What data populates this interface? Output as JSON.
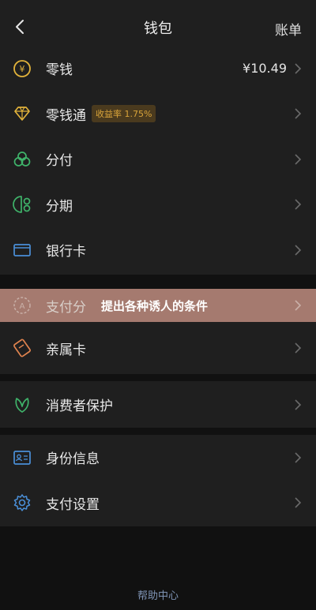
{
  "header": {
    "title": "钱包",
    "bill_label": "账单"
  },
  "group1": [
    {
      "label": "零钱",
      "value": "¥10.49",
      "icon": "coin-icon"
    },
    {
      "label": "零钱通",
      "badge": "收益率 1.75%",
      "icon": "diamond-icon"
    },
    {
      "label": "分付",
      "icon": "clover-icon"
    },
    {
      "label": "分期",
      "icon": "installment-icon"
    },
    {
      "label": "银行卡",
      "icon": "bank-card-icon"
    }
  ],
  "highlight_row": {
    "label": "支付分",
    "overlay_text": "提出各种诱人的条件",
    "icon": "score-icon"
  },
  "group2": [
    {
      "label": "亲属卡",
      "icon": "family-card-icon"
    }
  ],
  "group3": [
    {
      "label": "消费者保护",
      "icon": "leaf-shield-icon"
    }
  ],
  "group4": [
    {
      "label": "身份信息",
      "icon": "id-card-icon"
    },
    {
      "label": "支付设置",
      "icon": "gear-icon"
    }
  ],
  "footer": {
    "help_label": "帮助中心"
  },
  "colors": {
    "background": "#111111",
    "panel": "#1f1f1f",
    "gold": "#e2b33b",
    "green": "#3fb36a",
    "blue": "#4a8fd8",
    "orange": "#e0834e",
    "highlight": "#c08d80",
    "help_link": "#7f94b5"
  }
}
